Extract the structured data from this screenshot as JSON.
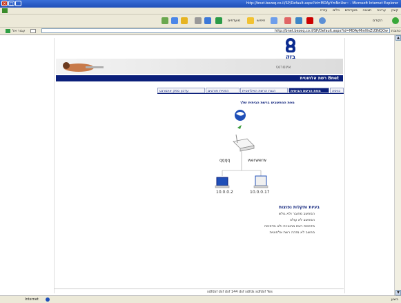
{
  "window": {
    "title": "http://bnet.bezeq.co.il/SP/Default.aspx?id=MDAyYmNnUw~ - Microsoft Internet Explorer"
  },
  "menu": {
    "items": [
      "קובץ",
      "עריכה",
      "תצוגה",
      "מועדפים",
      "כלים",
      "עזרה"
    ]
  },
  "toolbar": {
    "back_label": "הקודם",
    "search_label": "חיפוש",
    "favorites_label": "מועדפים"
  },
  "address": {
    "label": "כתובת",
    "url": "http://bnet.bezeq.co.il/SP/Default.aspx?id=MDAyMmNnZU3NQOw",
    "go_label": "עבור אל",
    "links_label": "קישורים"
  },
  "brand": {
    "logo_text": "בזק",
    "subtitle": "אינטרנט",
    "section_title": "רשת אלחוטית Bnet"
  },
  "tabs": [
    {
      "label": "כניסה"
    },
    {
      "label": "מפת הרשת הביתית"
    },
    {
      "label": "הגנת הרשת האלחוטית"
    },
    {
      "label": "הפניית פורטים"
    },
    {
      "label": "עדכון ספק אינטרנט"
    }
  ],
  "map": {
    "title": "מפת המחשבים ברשת הביתית שלך",
    "router_left_label": "qqqq",
    "router_right_label": "werwerw",
    "client1_ip": "10.0.0.2",
    "client2_ip": "10.0.0.17"
  },
  "issues": {
    "title": "בעיות ותקלות נפוצות",
    "items": [
      "המחשב מחובר ולא גולש",
      "המחשב לא עולה",
      "מדפסת רשת מחוברת ולא מדפיסה",
      "מחשב לא מזהה רשת אלחוטית"
    ]
  },
  "footer": {
    "text": "sdfdsf dsf dsf 144 dsf sdfds sdfdsf Yes"
  },
  "status": {
    "zone": "Internet",
    "done": "בוצע"
  },
  "colors": {
    "brand_navy": "#0b1f7a",
    "titlebar_blue": "#2a5cc8"
  }
}
